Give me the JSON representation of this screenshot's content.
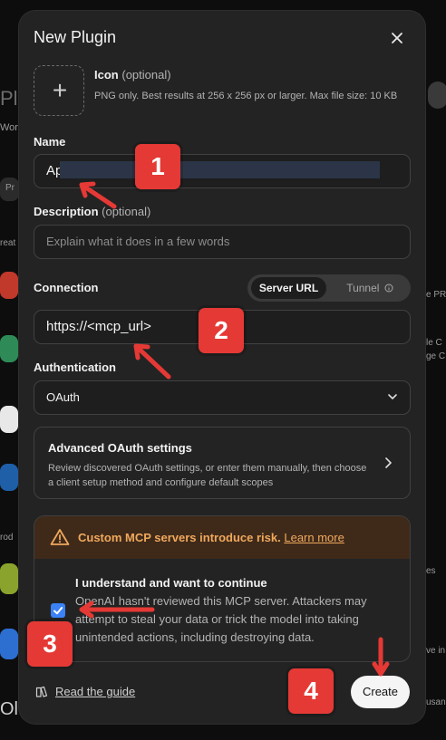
{
  "modal": {
    "title": "New Plugin",
    "icon_section": {
      "label": "Icon",
      "optional": "(optional)",
      "help": "PNG only. Best results at 256 x 256 px or larger. Max file size: 10 KB"
    },
    "name": {
      "label": "Name",
      "value": "App"
    },
    "description": {
      "label": "Description",
      "optional": "(optional)",
      "placeholder": "Explain what it does in a few words"
    },
    "connection": {
      "label": "Connection",
      "options": [
        "Server URL",
        "Tunnel"
      ],
      "selected": "Server URL",
      "url_value": "https://<mcp_url>"
    },
    "authentication": {
      "label": "Authentication",
      "value": "OAuth"
    },
    "advanced": {
      "title": "Advanced OAuth settings",
      "description": "Review discovered OAuth settings, or enter them manually, then choose a client setup method and configure default scopes"
    },
    "warning": {
      "title": "Custom MCP servers introduce risk.",
      "link": "Learn more",
      "checkbox_title": "I understand and want to continue",
      "checkbox_text": "OpenAI hasn't reviewed this MCP server. Attackers may attempt to steal your data or trick the model into taking unintended actions, including destroying data.",
      "checked": true
    },
    "footer": {
      "guide_link": "Read the guide",
      "create_button": "Create"
    }
  },
  "annotations": {
    "badges": [
      "1",
      "2",
      "3",
      "4"
    ],
    "color": "#e53935"
  },
  "background_text": [
    "Plu",
    "Wor",
    "Pr",
    "reat",
    "rod",
    "Ol",
    "e PR",
    "le C",
    "ge C",
    "es",
    "ve in",
    "usan"
  ],
  "colors": {
    "modal_bg": "#232323",
    "accent": "#3b82f6",
    "warning": "#f0a85c",
    "badge": "#e53935"
  }
}
